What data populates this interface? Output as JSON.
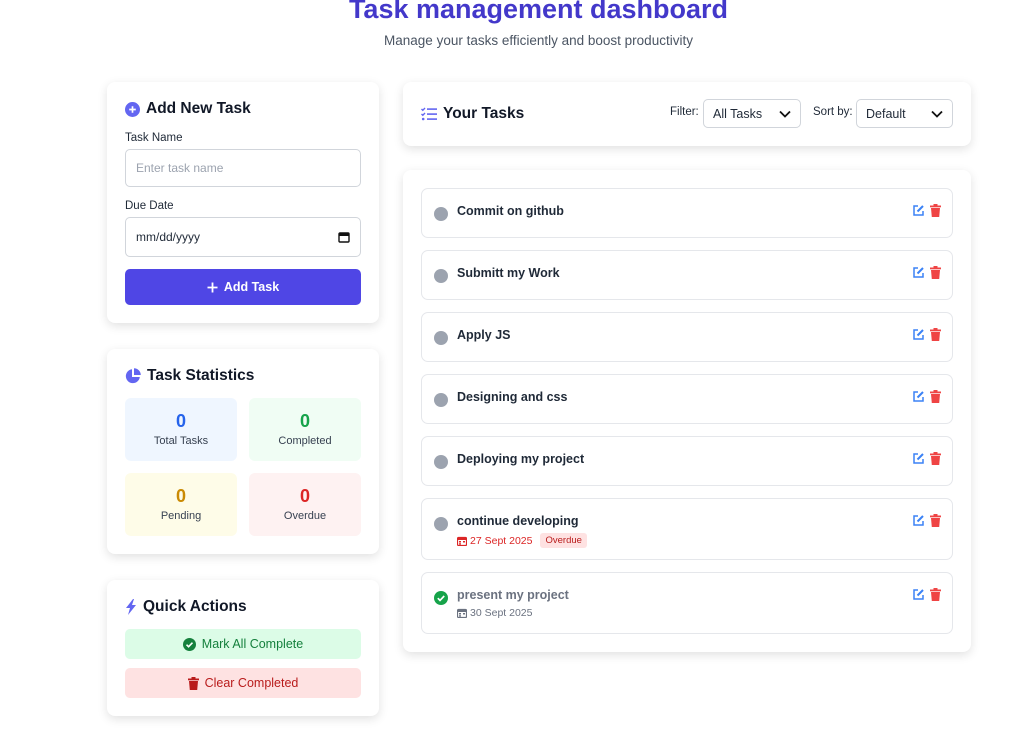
{
  "header": {
    "title": "Task management dashboard",
    "subtitle": "Manage your tasks efficiently and boost productivity"
  },
  "add_task": {
    "title": "Add New Task",
    "task_name_label": "Task Name",
    "task_name_placeholder": "Enter task name",
    "due_date_label": "Due Date",
    "due_date_placeholder": "mm/dd/yyyy",
    "add_button": "Add Task"
  },
  "statistics": {
    "title": "Task Statistics",
    "total": {
      "value": "0",
      "label": "Total Tasks"
    },
    "completed": {
      "value": "0",
      "label": "Completed"
    },
    "pending": {
      "value": "0",
      "label": "Pending"
    },
    "overdue": {
      "value": "0",
      "label": "Overdue"
    }
  },
  "quick_actions": {
    "title": "Quick Actions",
    "mark_all": "Mark All Complete",
    "clear_completed": "Clear Completed"
  },
  "tasks_panel": {
    "title": "Your Tasks",
    "filter_label": "Filter:",
    "filter_value": "All Tasks",
    "sort_label": "Sort by:",
    "sort_value": "Default"
  },
  "tasks": [
    {
      "name": "Commit on github"
    },
    {
      "name": "Submitt my Work"
    },
    {
      "name": "Apply JS"
    },
    {
      "name": "Designing and css"
    },
    {
      "name": "Deploying my project"
    },
    {
      "name": "continue developing",
      "date": "27 Sept 2025",
      "badge": "Overdue"
    },
    {
      "name": "present my project",
      "date": "30 Sept 2025",
      "completed": true
    }
  ],
  "colors": {
    "accent": "#4f46e5",
    "title": "#4338ca",
    "blue": "#2563eb",
    "green": "#16a34a",
    "yellow": "#ca8a04",
    "red": "#dc2626"
  }
}
